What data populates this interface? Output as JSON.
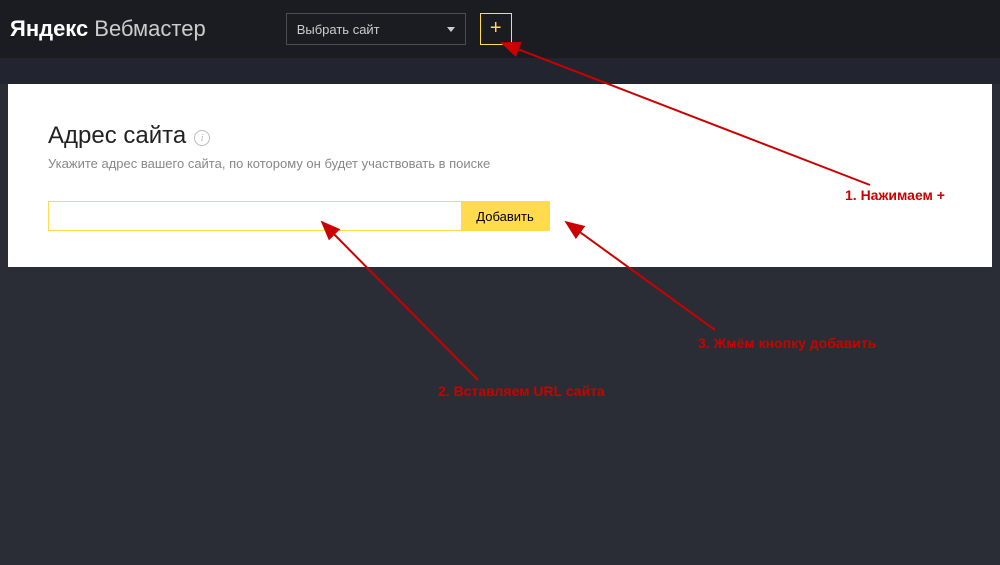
{
  "header": {
    "logo_yandex": "Яндекс",
    "logo_webmaster": "Вебмастер",
    "site_select_label": "Выбрать сайт",
    "add_button_label": "+"
  },
  "main": {
    "title": "Адрес сайта",
    "info_glyph": "i",
    "subtitle": "Укажите адрес вашего сайта, по которому он будет участвовать в поиске",
    "url_value": "",
    "submit_label": "Добавить"
  },
  "annotations": {
    "step1": "1. Нажимаем +",
    "step2": "2. Вставляем URL сайта",
    "step3": "3. Жмём кнопку добавить"
  },
  "colors": {
    "accent": "#ffdb4d",
    "annotation": "#cc0000",
    "dark_bg": "#1a1c21",
    "body_bg": "#2a2d35"
  }
}
